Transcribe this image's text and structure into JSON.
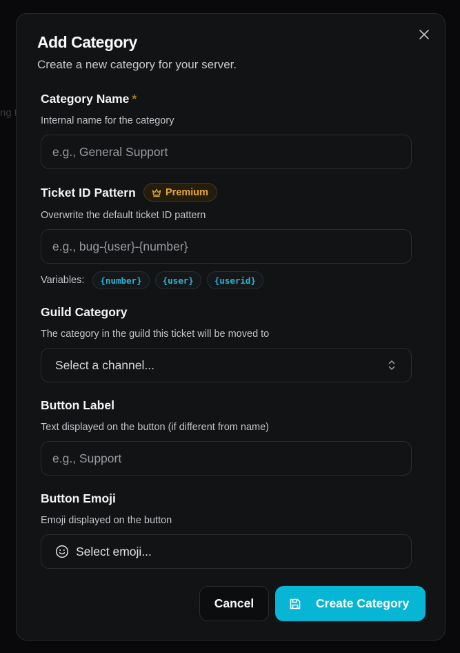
{
  "background": {
    "snippet": "ng t"
  },
  "modal": {
    "title": "Add Category",
    "subtitle": "Create a new category for your server.",
    "close_icon": "close-icon"
  },
  "fields": {
    "category_name": {
      "label": "Category Name",
      "required_mark": "*",
      "description": "Internal name for the category",
      "placeholder": "e.g., General Support"
    },
    "ticket_id_pattern": {
      "label": "Ticket ID Pattern",
      "badge": "Premium",
      "badge_icon": "crown-icon",
      "description": "Overwrite the default ticket ID pattern",
      "placeholder": "e.g., bug-{user}-{number}",
      "variables_label": "Variables:",
      "variables": [
        "{number}",
        "{user}",
        "{userid}"
      ]
    },
    "guild_category": {
      "label": "Guild Category",
      "description": "The category in the guild this ticket will be moved to",
      "placeholder": "Select a channel...",
      "chevron_icon": "chevrons-up-down-icon"
    },
    "button_label": {
      "label": "Button Label",
      "description": "Text displayed on the button (if different from name)",
      "placeholder": "e.g., Support"
    },
    "button_emoji": {
      "label": "Button Emoji",
      "description": "Emoji displayed on the button",
      "placeholder": "Select emoji...",
      "icon": "smile-icon"
    }
  },
  "actions": {
    "cancel_label": "Cancel",
    "create_label": "Create Category",
    "create_icon": "save-icon"
  },
  "colors": {
    "accent": "#06b6d4",
    "premium": "#e5aa2d",
    "variable_chip_text": "#2bb3cf",
    "modal_bg": "#111315"
  }
}
